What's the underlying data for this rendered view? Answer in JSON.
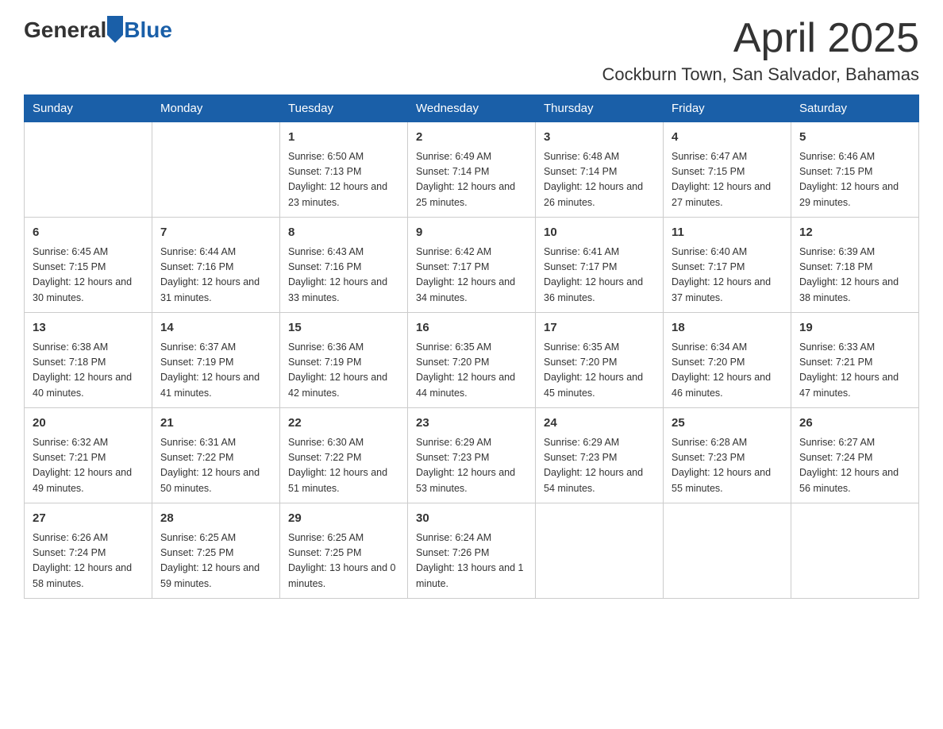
{
  "header": {
    "logo_general": "General",
    "logo_blue": "Blue",
    "month_title": "April 2025",
    "location": "Cockburn Town, San Salvador, Bahamas"
  },
  "weekdays": [
    "Sunday",
    "Monday",
    "Tuesday",
    "Wednesday",
    "Thursday",
    "Friday",
    "Saturday"
  ],
  "weeks": [
    [
      {
        "day": "",
        "sunrise": "",
        "sunset": "",
        "daylight": ""
      },
      {
        "day": "",
        "sunrise": "",
        "sunset": "",
        "daylight": ""
      },
      {
        "day": "1",
        "sunrise": "Sunrise: 6:50 AM",
        "sunset": "Sunset: 7:13 PM",
        "daylight": "Daylight: 12 hours and 23 minutes."
      },
      {
        "day": "2",
        "sunrise": "Sunrise: 6:49 AM",
        "sunset": "Sunset: 7:14 PM",
        "daylight": "Daylight: 12 hours and 25 minutes."
      },
      {
        "day": "3",
        "sunrise": "Sunrise: 6:48 AM",
        "sunset": "Sunset: 7:14 PM",
        "daylight": "Daylight: 12 hours and 26 minutes."
      },
      {
        "day": "4",
        "sunrise": "Sunrise: 6:47 AM",
        "sunset": "Sunset: 7:15 PM",
        "daylight": "Daylight: 12 hours and 27 minutes."
      },
      {
        "day": "5",
        "sunrise": "Sunrise: 6:46 AM",
        "sunset": "Sunset: 7:15 PM",
        "daylight": "Daylight: 12 hours and 29 minutes."
      }
    ],
    [
      {
        "day": "6",
        "sunrise": "Sunrise: 6:45 AM",
        "sunset": "Sunset: 7:15 PM",
        "daylight": "Daylight: 12 hours and 30 minutes."
      },
      {
        "day": "7",
        "sunrise": "Sunrise: 6:44 AM",
        "sunset": "Sunset: 7:16 PM",
        "daylight": "Daylight: 12 hours and 31 minutes."
      },
      {
        "day": "8",
        "sunrise": "Sunrise: 6:43 AM",
        "sunset": "Sunset: 7:16 PM",
        "daylight": "Daylight: 12 hours and 33 minutes."
      },
      {
        "day": "9",
        "sunrise": "Sunrise: 6:42 AM",
        "sunset": "Sunset: 7:17 PM",
        "daylight": "Daylight: 12 hours and 34 minutes."
      },
      {
        "day": "10",
        "sunrise": "Sunrise: 6:41 AM",
        "sunset": "Sunset: 7:17 PM",
        "daylight": "Daylight: 12 hours and 36 minutes."
      },
      {
        "day": "11",
        "sunrise": "Sunrise: 6:40 AM",
        "sunset": "Sunset: 7:17 PM",
        "daylight": "Daylight: 12 hours and 37 minutes."
      },
      {
        "day": "12",
        "sunrise": "Sunrise: 6:39 AM",
        "sunset": "Sunset: 7:18 PM",
        "daylight": "Daylight: 12 hours and 38 minutes."
      }
    ],
    [
      {
        "day": "13",
        "sunrise": "Sunrise: 6:38 AM",
        "sunset": "Sunset: 7:18 PM",
        "daylight": "Daylight: 12 hours and 40 minutes."
      },
      {
        "day": "14",
        "sunrise": "Sunrise: 6:37 AM",
        "sunset": "Sunset: 7:19 PM",
        "daylight": "Daylight: 12 hours and 41 minutes."
      },
      {
        "day": "15",
        "sunrise": "Sunrise: 6:36 AM",
        "sunset": "Sunset: 7:19 PM",
        "daylight": "Daylight: 12 hours and 42 minutes."
      },
      {
        "day": "16",
        "sunrise": "Sunrise: 6:35 AM",
        "sunset": "Sunset: 7:20 PM",
        "daylight": "Daylight: 12 hours and 44 minutes."
      },
      {
        "day": "17",
        "sunrise": "Sunrise: 6:35 AM",
        "sunset": "Sunset: 7:20 PM",
        "daylight": "Daylight: 12 hours and 45 minutes."
      },
      {
        "day": "18",
        "sunrise": "Sunrise: 6:34 AM",
        "sunset": "Sunset: 7:20 PM",
        "daylight": "Daylight: 12 hours and 46 minutes."
      },
      {
        "day": "19",
        "sunrise": "Sunrise: 6:33 AM",
        "sunset": "Sunset: 7:21 PM",
        "daylight": "Daylight: 12 hours and 47 minutes."
      }
    ],
    [
      {
        "day": "20",
        "sunrise": "Sunrise: 6:32 AM",
        "sunset": "Sunset: 7:21 PM",
        "daylight": "Daylight: 12 hours and 49 minutes."
      },
      {
        "day": "21",
        "sunrise": "Sunrise: 6:31 AM",
        "sunset": "Sunset: 7:22 PM",
        "daylight": "Daylight: 12 hours and 50 minutes."
      },
      {
        "day": "22",
        "sunrise": "Sunrise: 6:30 AM",
        "sunset": "Sunset: 7:22 PM",
        "daylight": "Daylight: 12 hours and 51 minutes."
      },
      {
        "day": "23",
        "sunrise": "Sunrise: 6:29 AM",
        "sunset": "Sunset: 7:23 PM",
        "daylight": "Daylight: 12 hours and 53 minutes."
      },
      {
        "day": "24",
        "sunrise": "Sunrise: 6:29 AM",
        "sunset": "Sunset: 7:23 PM",
        "daylight": "Daylight: 12 hours and 54 minutes."
      },
      {
        "day": "25",
        "sunrise": "Sunrise: 6:28 AM",
        "sunset": "Sunset: 7:23 PM",
        "daylight": "Daylight: 12 hours and 55 minutes."
      },
      {
        "day": "26",
        "sunrise": "Sunrise: 6:27 AM",
        "sunset": "Sunset: 7:24 PM",
        "daylight": "Daylight: 12 hours and 56 minutes."
      }
    ],
    [
      {
        "day": "27",
        "sunrise": "Sunrise: 6:26 AM",
        "sunset": "Sunset: 7:24 PM",
        "daylight": "Daylight: 12 hours and 58 minutes."
      },
      {
        "day": "28",
        "sunrise": "Sunrise: 6:25 AM",
        "sunset": "Sunset: 7:25 PM",
        "daylight": "Daylight: 12 hours and 59 minutes."
      },
      {
        "day": "29",
        "sunrise": "Sunrise: 6:25 AM",
        "sunset": "Sunset: 7:25 PM",
        "daylight": "Daylight: 13 hours and 0 minutes."
      },
      {
        "day": "30",
        "sunrise": "Sunrise: 6:24 AM",
        "sunset": "Sunset: 7:26 PM",
        "daylight": "Daylight: 13 hours and 1 minute."
      },
      {
        "day": "",
        "sunrise": "",
        "sunset": "",
        "daylight": ""
      },
      {
        "day": "",
        "sunrise": "",
        "sunset": "",
        "daylight": ""
      },
      {
        "day": "",
        "sunrise": "",
        "sunset": "",
        "daylight": ""
      }
    ]
  ]
}
